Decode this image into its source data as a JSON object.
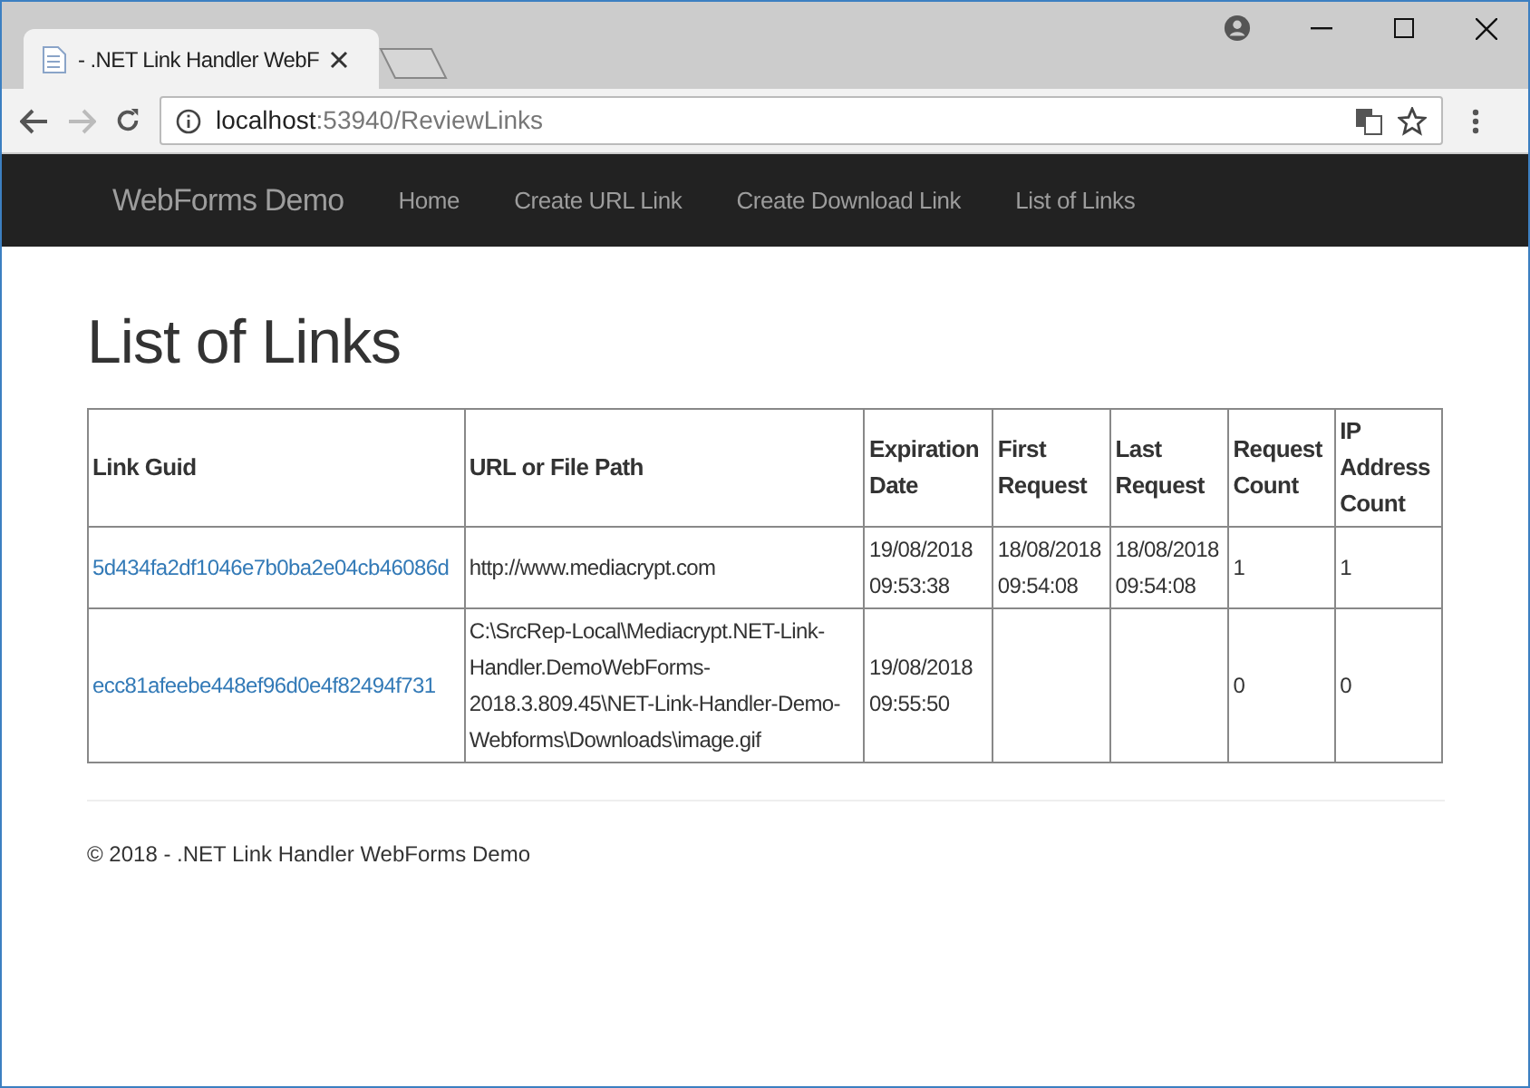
{
  "browser": {
    "tab_title": "- .NET Link Handler WebF",
    "address_host": "localhost",
    "address_path": ":53940/ReviewLinks"
  },
  "navbar": {
    "brand": "WebForms Demo",
    "links": [
      {
        "label": "Home"
      },
      {
        "label": "Create URL Link"
      },
      {
        "label": "Create Download Link"
      },
      {
        "label": "List of Links"
      }
    ]
  },
  "heading": "List of Links",
  "table": {
    "columns": [
      "Link Guid",
      "URL or File Path",
      "Expiration Date",
      "First Request",
      "Last Request",
      "Request Count",
      "IP Address Count"
    ],
    "rows": [
      {
        "link_guid": "5d434fa2df1046e7b0ba2e04cb46086d",
        "url_or_file_path": "http://www.mediacrypt.com",
        "expiration_date": "19/08/2018 09:53:38",
        "first_request": "18/08/2018 09:54:08",
        "last_request": "18/08/2018 09:54:08",
        "request_count": "1",
        "ip_address_count": "1"
      },
      {
        "link_guid": "ecc81afeebe448ef96d0e4f82494f731",
        "url_or_file_path": "C:\\SrcRep-Local\\Mediacrypt.NET-Link-Handler.DemoWebForms-2018.3.809.45\\NET-Link-Handler-Demo-Webforms\\Downloads\\image.gif",
        "expiration_date": "19/08/2018 09:55:50",
        "request_count": "0",
        "ip_address_count": "0"
      }
    ]
  },
  "footer": "© 2018 - .NET Link Handler WebForms Demo"
}
